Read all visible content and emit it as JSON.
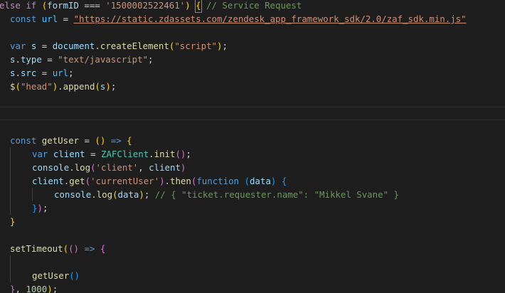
{
  "editor": {
    "line1": {
      "else": "else",
      "if": "if",
      "open": "(",
      "formID": "formID",
      "op": " === ",
      "value": "'1500002522461'",
      "close": ")",
      "brace": "{",
      "comment": "// Service Request"
    },
    "line2": {
      "const": "const",
      "name": "url",
      "eq": " = ",
      "url_value": "\"https://static.zdassets.com/zendesk_app_framework_sdk/2.0/zaf_sdk.min.js\""
    },
    "line3": {
      "var": "var",
      "s": "s",
      "eq": " = ",
      "document": "document",
      "dot": ".",
      "createElement": "createElement",
      "open": "(",
      "arg": "\"script\"",
      "close": ")",
      "semi": ";"
    },
    "line4": {
      "s": "s",
      "dot": ".",
      "type": "type",
      "eq": " = ",
      "value": "\"text/javascript\"",
      "semi": ";"
    },
    "line5": {
      "s": "s",
      "dot": ".",
      "src": "src",
      "eq": " = ",
      "url": "url",
      "semi": ";"
    },
    "line6": {
      "dollar": "$",
      "open": "(",
      "arg": "\"head\"",
      "close": ")",
      "dot": ".",
      "append": "append",
      "open2": "(",
      "s": "s",
      "close2": ")",
      "semi": ";"
    },
    "line7": {
      "const": "const",
      "name": "getUser",
      "eq": " = ",
      "parens": "()",
      "arrow": " => ",
      "brace": "{"
    },
    "line8": {
      "var": "var",
      "client": "client",
      "eq": " = ",
      "ZAFClient": "ZAFClient",
      "dot": ".",
      "init": "init",
      "parens": "()",
      "semi": ";"
    },
    "line9": {
      "console": "console",
      "dot": ".",
      "log": "log",
      "open": "(",
      "arg": "'client'",
      "comma": ", ",
      "client": "client",
      "close": ")"
    },
    "line10": {
      "client": "client",
      "dot": ".",
      "get": "get",
      "open": "(",
      "arg": "'currentUser'",
      "close": ")",
      "dot2": ".",
      "then": "then",
      "open2": "(",
      "function": "function",
      "sp": " ",
      "open3": "(",
      "data": "data",
      "close3": ")",
      "brace": " {"
    },
    "line11": {
      "console": "console",
      "dot": ".",
      "log": "log",
      "open": "(",
      "data": "data",
      "close": ")",
      "semi": "; ",
      "comment": "// { \"ticket.requester.name\": \"Mikkel Svane\" }"
    },
    "line12": {
      "brace": "}",
      "close": ")",
      "semi": ";"
    },
    "line13": {
      "brace": "}"
    },
    "line14": {
      "setTimeout": "setTimeout",
      "open": "(",
      "parens": "()",
      "arrow": " => ",
      "brace": "{"
    },
    "line15": {
      "getUser": "getUser",
      "parens": "()"
    },
    "line16": {
      "brace": "}",
      "comma": ", ",
      "num": "1000",
      "close": ")",
      "semi": ";"
    }
  },
  "colors": {
    "background": "#1e1e1e",
    "keyword_control": "#c586c0",
    "keyword_decl": "#569cd6",
    "variable": "#9cdcfe",
    "constant": "#4fc1ff",
    "function": "#dcdcaa",
    "class": "#4ec9b0",
    "string": "#ce9178",
    "number": "#b5cea8",
    "comment": "#6a9955",
    "bracket_level1": "#ffd700",
    "bracket_level2": "#da70d6",
    "bracket_level3": "#179fff"
  }
}
